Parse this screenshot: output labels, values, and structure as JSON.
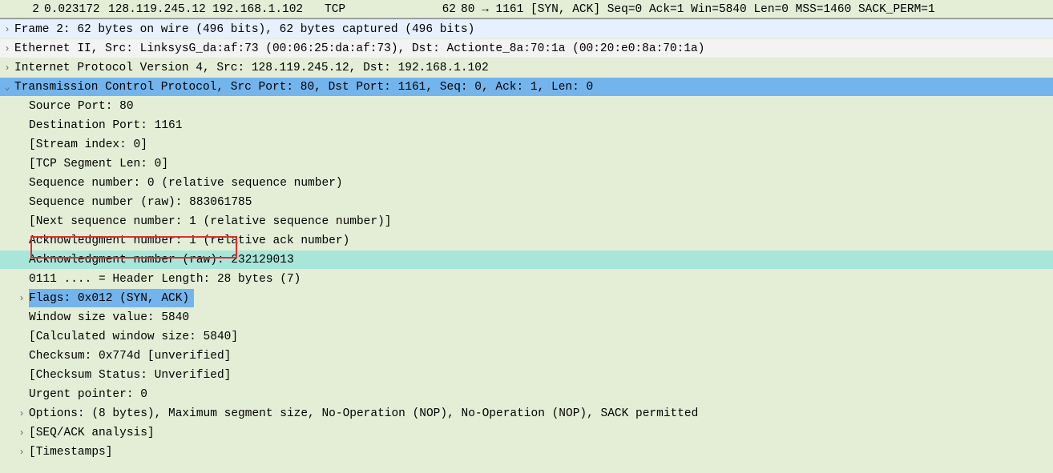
{
  "packet_list": {
    "no": "2",
    "time": "0.023172",
    "src": "128.119.245.12",
    "dst": "192.168.1.102",
    "proto": "TCP",
    "len": "62",
    "info": "80 → 1161 [SYN, ACK] Seq=0 Ack=1 Win=5840 Len=0 MSS=1460 SACK_PERM=1"
  },
  "tree": {
    "frame": "Frame 2: 62 bytes on wire (496 bits), 62 bytes captured (496 bits)",
    "eth": "Ethernet II, Src: LinksysG_da:af:73 (00:06:25:da:af:73), Dst: Actionte_8a:70:1a (00:20:e0:8a:70:1a)",
    "ip": "Internet Protocol Version 4, Src: 128.119.245.12, Dst: 192.168.1.102",
    "tcp": "Transmission Control Protocol, Src Port: 80, Dst Port: 1161, Seq: 0, Ack: 1, Len: 0",
    "srcport": "Source Port: 80",
    "dstport": "Destination Port: 1161",
    "streamidx": "[Stream index: 0]",
    "seglen": "[TCP Segment Len: 0]",
    "seqrel": "Sequence number: 0    (relative sequence number)",
    "seqraw": "Sequence number (raw): 883061785",
    "nextseq": "[Next sequence number: 1    (relative sequence number)]",
    "ackrel": "Acknowledgment number: 1    (relative ack number)",
    "ackraw": "Acknowledgment number (raw): 232129013",
    "hdrlen": "0111 .... = Header Length: 28 bytes (7)",
    "flags": "Flags: 0x012 (SYN, ACK)",
    "win": "Window size value: 5840",
    "wincalc": "[Calculated window size: 5840]",
    "cksum": "Checksum: 0x774d [unverified]",
    "cksumstat": "[Checksum Status: Unverified]",
    "urg": "Urgent pointer: 0",
    "options": "Options: (8 bytes), Maximum segment size, No-Operation (NOP), No-Operation (NOP), SACK permitted",
    "seqack": "[SEQ/ACK analysis]",
    "timestamps": "[Timestamps]"
  }
}
